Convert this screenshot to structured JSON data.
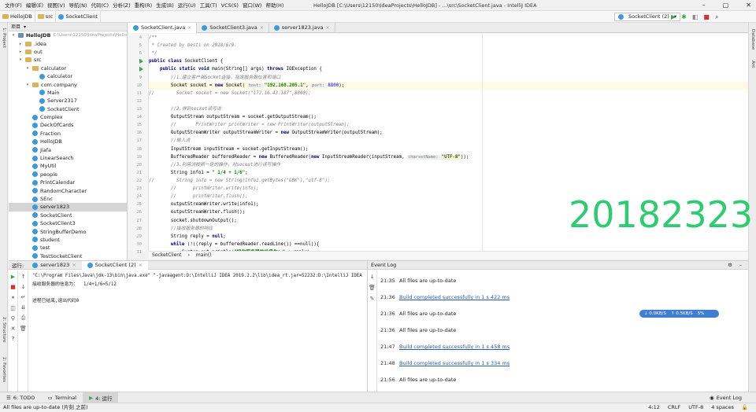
{
  "menu": [
    "文件(F)",
    "编辑(E)",
    "视图(V)",
    "导航(N)",
    "代码(C)",
    "分析(Z)",
    "重构(R)",
    "生成(B)",
    "运行(U)",
    "工具(T)",
    "VCS(S)",
    "窗口(W)",
    "帮助(H)"
  ],
  "window_title": "HelloJDB [C:\\Users\\12150\\IdeaProjects\\HelloJDB] - ...\\src\\SocketClient.java - IntelliJ IDEA",
  "breadcrumb": [
    "HelloJDB",
    "src",
    "SocketClient"
  ],
  "run_config": "SocketClient (2)",
  "left_stripe": [
    "1: Project",
    "2: Structure",
    "2: Favorites"
  ],
  "right_stripe": [
    "Database",
    "Ant"
  ],
  "project": {
    "header": "项目",
    "tree": [
      {
        "label": "HelloJDB",
        "extra": "C:\\Users\\12150\\IdeaProjects\\Hello",
        "indent": 0,
        "arrow": "▾",
        "icon": "mod"
      },
      {
        "label": ".idea",
        "indent": 1,
        "arrow": "▸",
        "icon": "folder"
      },
      {
        "label": "out",
        "indent": 1,
        "arrow": "▸",
        "icon": "folder"
      },
      {
        "label": "src",
        "indent": 1,
        "arrow": "▾",
        "icon": "folder"
      },
      {
        "label": "calculator",
        "indent": 2,
        "arrow": "▾",
        "icon": "folder"
      },
      {
        "label": "calculator",
        "indent": 3,
        "arrow": "",
        "icon": "class"
      },
      {
        "label": "com.company",
        "indent": 2,
        "arrow": "▾",
        "icon": "folder"
      },
      {
        "label": "Main",
        "indent": 3,
        "arrow": "",
        "icon": "class"
      },
      {
        "label": "Server2317",
        "indent": 3,
        "arrow": "",
        "icon": "class"
      },
      {
        "label": "SocketClient",
        "indent": 3,
        "arrow": "",
        "icon": "class"
      },
      {
        "label": "Complex",
        "indent": 2,
        "arrow": "",
        "icon": "class"
      },
      {
        "label": "DeckOfCards",
        "indent": 2,
        "arrow": "",
        "icon": "class"
      },
      {
        "label": "Fraction",
        "indent": 2,
        "arrow": "",
        "icon": "class"
      },
      {
        "label": "HelloJDB",
        "indent": 2,
        "arrow": "",
        "icon": "class"
      },
      {
        "label": "Jiafa",
        "indent": 2,
        "arrow": "",
        "icon": "class"
      },
      {
        "label": "LinearSearch",
        "indent": 2,
        "arrow": "",
        "icon": "class"
      },
      {
        "label": "MyUtil",
        "indent": 2,
        "arrow": "",
        "icon": "class"
      },
      {
        "label": "people",
        "indent": 2,
        "arrow": "",
        "icon": "class"
      },
      {
        "label": "PrintCalendar",
        "indent": 2,
        "arrow": "",
        "icon": "class"
      },
      {
        "label": "RandomCharacter",
        "indent": 2,
        "arrow": "",
        "icon": "class"
      },
      {
        "label": "SEnc",
        "indent": 2,
        "arrow": "",
        "icon": "class"
      },
      {
        "label": "server1823",
        "indent": 2,
        "arrow": "",
        "icon": "class",
        "selected": true
      },
      {
        "label": "SocketClient",
        "indent": 2,
        "arrow": "",
        "icon": "class"
      },
      {
        "label": "SocketClient3",
        "indent": 2,
        "arrow": "",
        "icon": "class"
      },
      {
        "label": "StringBufferDemo",
        "indent": 2,
        "arrow": "",
        "icon": "class"
      },
      {
        "label": "student",
        "indent": 2,
        "arrow": "",
        "icon": "class"
      },
      {
        "label": "test",
        "indent": 2,
        "arrow": "",
        "icon": "class"
      },
      {
        "label": "TestSocketClient",
        "indent": 2,
        "arrow": "",
        "icon": "class"
      }
    ]
  },
  "editor": {
    "tabs": [
      "SocketClient.java",
      "SocketClient3.java",
      "server1823.java"
    ],
    "active_tab": 0,
    "first_line": 4,
    "code": [
      [
        [
          "cm",
          "/**"
        ]
      ],
      [
        [
          "cm",
          " * Created by besti on 2018/6/9."
        ]
      ],
      [
        [
          "cm",
          " */"
        ]
      ],
      [
        [
          "kw",
          "public class "
        ],
        [
          "",
          "SocketClient {"
        ]
      ],
      [
        [
          "",
          "    "
        ],
        [
          "kw",
          "public static void "
        ],
        [
          "",
          "main(String[] args) "
        ],
        [
          "kw",
          "throws "
        ],
        [
          "",
          "IOException {"
        ]
      ],
      [
        [
          "",
          "        "
        ],
        [
          "cm",
          "//1.建立客户端Socket连接，指定服务器位置和端口"
        ]
      ],
      [
        [
          "",
          "        Socket socket = "
        ],
        [
          "kw",
          "new "
        ],
        [
          "",
          "Socket( "
        ],
        [
          "hint",
          "host: "
        ],
        [
          "str",
          "\"192.168.205.1\""
        ],
        [
          "",
          ", "
        ],
        [
          "hint",
          "port: "
        ],
        [
          "num",
          "8800"
        ],
        [
          "",
          ");"
        ]
      ],
      [
        [
          "cm",
          "//        Socket socket = new Socket(\"172.16.43.187\",8800);"
        ]
      ],
      [
        [
          "",
          ""
        ]
      ],
      [
        [
          "",
          "        "
        ],
        [
          "cm",
          "//2.得到socket读写流"
        ]
      ],
      [
        [
          "",
          "        OutputStream outputStream = socket.getOutputStream();"
        ]
      ],
      [
        [
          "",
          "        "
        ],
        [
          "cm",
          "//       PrintWriter printWriter = new PrintWriter(outputStream);"
        ]
      ],
      [
        [
          "",
          "        OutputStreamWriter outputStreamWriter = "
        ],
        [
          "kw",
          "new "
        ],
        [
          "",
          "OutputStreamWriter(outputStream);"
        ]
      ],
      [
        [
          "",
          "        "
        ],
        [
          "cm",
          "//输入流"
        ]
      ],
      [
        [
          "",
          "        InputStream inputStream = socket.getInputStream();"
        ]
      ],
      [
        [
          "",
          "        BufferedReader bufferedReader = "
        ],
        [
          "kw",
          "new "
        ],
        [
          "",
          "BufferedReader("
        ],
        [
          "kw",
          "new "
        ],
        [
          "",
          "InputStreamReader(inputStream, "
        ],
        [
          "hint",
          "charsetName: "
        ],
        [
          "strbox",
          "\"UTF-8\""
        ],
        [
          "",
          "));"
        ]
      ],
      [
        [
          "",
          "        "
        ],
        [
          "cm",
          "//3.利用流按照一定的操作，对socket进行读写操作"
        ]
      ],
      [
        [
          "",
          "        String info1 = "
        ],
        [
          "str",
          "\" 1/4 + 1/6\""
        ],
        [
          "",
          ";"
        ]
      ],
      [
        [
          "cm",
          "//        String info = new String(info1.getBytes(\"GBK\"),\"utf-8\");"
        ]
      ],
      [
        [
          "",
          "        "
        ],
        [
          "cm",
          "//      printWriter.write(info);"
        ]
      ],
      [
        [
          "",
          "        "
        ],
        [
          "cm",
          "//      printWriter.flush();"
        ]
      ],
      [
        [
          "",
          "        outputStreamWriter.write(info1);"
        ]
      ],
      [
        [
          "",
          "        outputStreamWriter.flush();"
        ]
      ],
      [
        [
          "",
          "        socket.shutdownOutput();"
        ]
      ],
      [
        [
          "",
          "        "
        ],
        [
          "cm",
          "//接收服务器的响应"
        ]
      ],
      [
        [
          "",
          "        String reply = "
        ],
        [
          "kw",
          "null"
        ],
        [
          "",
          ";"
        ]
      ],
      [
        [
          "",
          "        "
        ],
        [
          "kw",
          "while "
        ],
        [
          "",
          "(!((reply = bufferedReader.readLine()) ==null)){"
        ]
      ],
      [
        [
          "",
          "            System."
        ],
        [
          "",
          "out"
        ],
        [
          "",
          ".println("
        ],
        [
          "str",
          "\"接收服务器的信息为：\""
        ],
        [
          "",
          " + reply);"
        ]
      ]
    ],
    "highlight_line_index": 6,
    "crumb": [
      "SocketClient",
      "main()"
    ],
    "overlay_number": "20182323"
  },
  "run": {
    "label": "运行:",
    "tabs": [
      "server1823",
      "SocketClient (2)"
    ],
    "active_tab": 1,
    "console": [
      "\"C:\\Program Files\\Java\\jdk-13\\bin\\java.exe\" \"-javaagent:D:\\IntelliJ IDEA 2019.2.2\\lib\\idea_rt.jar=52232:D:\\IntelliJ IDEA",
      "接收服务器的信息为：  1/4+1/6=5/12",
      "",
      "进程已结束,退出代码0"
    ]
  },
  "event_log": {
    "title": "Event Log",
    "entries": [
      {
        "time": "21:35",
        "text": "All files are up-to-date",
        "link": false
      },
      {
        "time": "21:36",
        "text": "Build completed successfully in 1 s 422 ms",
        "link": true
      },
      {
        "time": "21:36",
        "text": "All files are up-to-date",
        "link": false
      },
      {
        "time": "21:36",
        "text": "All files are up-to-date",
        "link": false
      },
      {
        "time": "21:47",
        "text": "Build completed successfully in 1 s 458 ms",
        "link": true
      },
      {
        "time": "21:48",
        "text": "Build completed successfully in 1 s 334 ms",
        "link": true
      },
      {
        "time": "21:56",
        "text": "All files are up-to-date",
        "link": false
      }
    ]
  },
  "net": {
    "down": "0.0KB/S",
    "up": "0.5KB/S",
    "pct": "5%"
  },
  "bottom_tools": [
    "6: TODO",
    "Terminal",
    "4: 运行"
  ],
  "bottom_right": "Event Log",
  "status": {
    "message": "All files are up-to-date (片刻 之前)",
    "position": "4:12",
    "line_sep": "CRLF",
    "encoding": "UTF-8",
    "indent": "4 spaces"
  }
}
